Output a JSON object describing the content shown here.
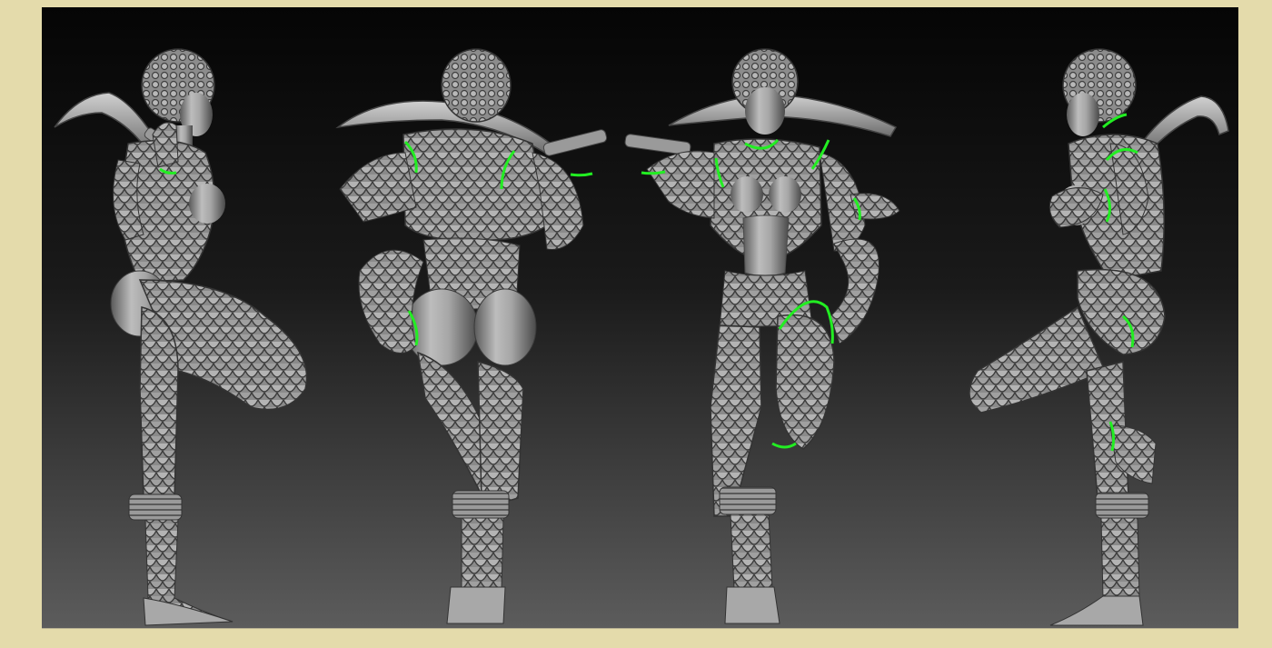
{
  "colors": {
    "frame": "#e4dbab",
    "viewport_top": "#050505",
    "viewport_bottom": "#5c5c5c",
    "sculpt_light": "#c2c2c2",
    "sculpt_mid": "#8e8e8e",
    "sculpt_dark": "#3e3e3e",
    "seam_lines": "#22ee22"
  },
  "views": [
    "left-side",
    "back",
    "front",
    "right-side"
  ]
}
